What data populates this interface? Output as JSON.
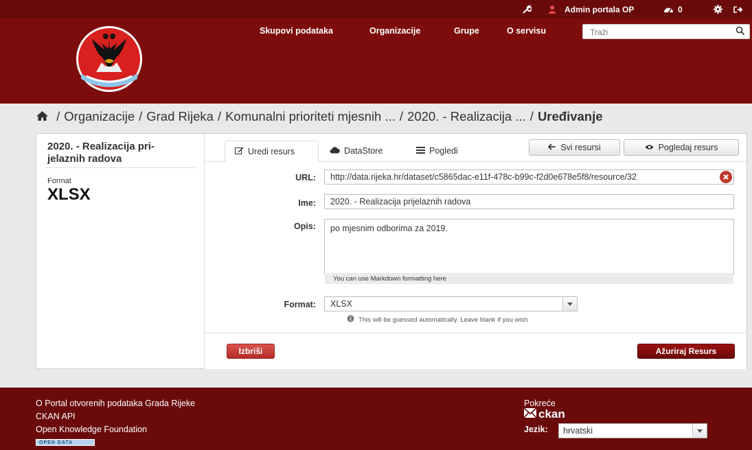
{
  "account": {
    "user_name": "Admin portala OP",
    "dashboard_count": "0"
  },
  "nav": {
    "items": [
      "Skupovi podataka",
      "Organizacije",
      "Grupe",
      "O servisu"
    ],
    "search_placeholder": "Traži"
  },
  "breadcrumb": {
    "items": [
      "Organizacije",
      "Grad Rijeka",
      "Komunalni prioriteti mjesnih ...",
      "2020. - Realizacija ..."
    ],
    "active": "Uređivanje",
    "separator": "/"
  },
  "sidebar": {
    "title": "2020. - Realizacija pri-jelaznih radova",
    "format_label": "Format",
    "format_value": "XLSX"
  },
  "tabs": [
    "Uredi resurs",
    "DataStore",
    "Pogledi"
  ],
  "actions": {
    "all_resources": "Svi resursi",
    "view_resource": "Pogledaj resurs"
  },
  "form": {
    "url_label": "URL:",
    "url_value": "http://data.rijeka.hr/dataset/c5865dac-e11f-478c-b99c-f2d0e678e5f8/resource/32",
    "name_label": "Ime:",
    "name_value": "2020. - Realizacija prijelaznih radova",
    "description_label": "Opis:",
    "description_value": "po mjesnim odborima za 2019.",
    "markdown_note": "You can use Markdown formatting here",
    "format_label": "Format:",
    "format_value": "XLSX",
    "format_hint": "This will be guessed automatically. Leave blank if you wish",
    "delete_label": "Izbriši",
    "update_label": "Ažuriraj Resurs"
  },
  "footer": {
    "links": [
      "O Portal otvorenih podataka Grada Rijeke",
      "CKAN API",
      "Open Knowledge Foundation"
    ],
    "open_data_badge": "OPEN DATA",
    "powered_by": "Pokreće",
    "ckan_logo_text": "ckan",
    "language_label": "Jezik:",
    "language_value": "hrvatski"
  },
  "colors": {
    "masthead": "#7d0c0c",
    "topbar": "#6a0a0a",
    "primary_button": "#8b0e0e",
    "danger_button": "#c9302c"
  },
  "icons": [
    "wrench-icon",
    "user-icon",
    "dashboard-icon",
    "gear-icon",
    "sign-out-icon",
    "search-icon",
    "home-icon",
    "pencil-icon",
    "cloud-icon",
    "list-icon",
    "arrow-left-icon",
    "eye-icon",
    "clear-icon",
    "info-icon",
    "caret-down-icon",
    "ckan-icon"
  ]
}
